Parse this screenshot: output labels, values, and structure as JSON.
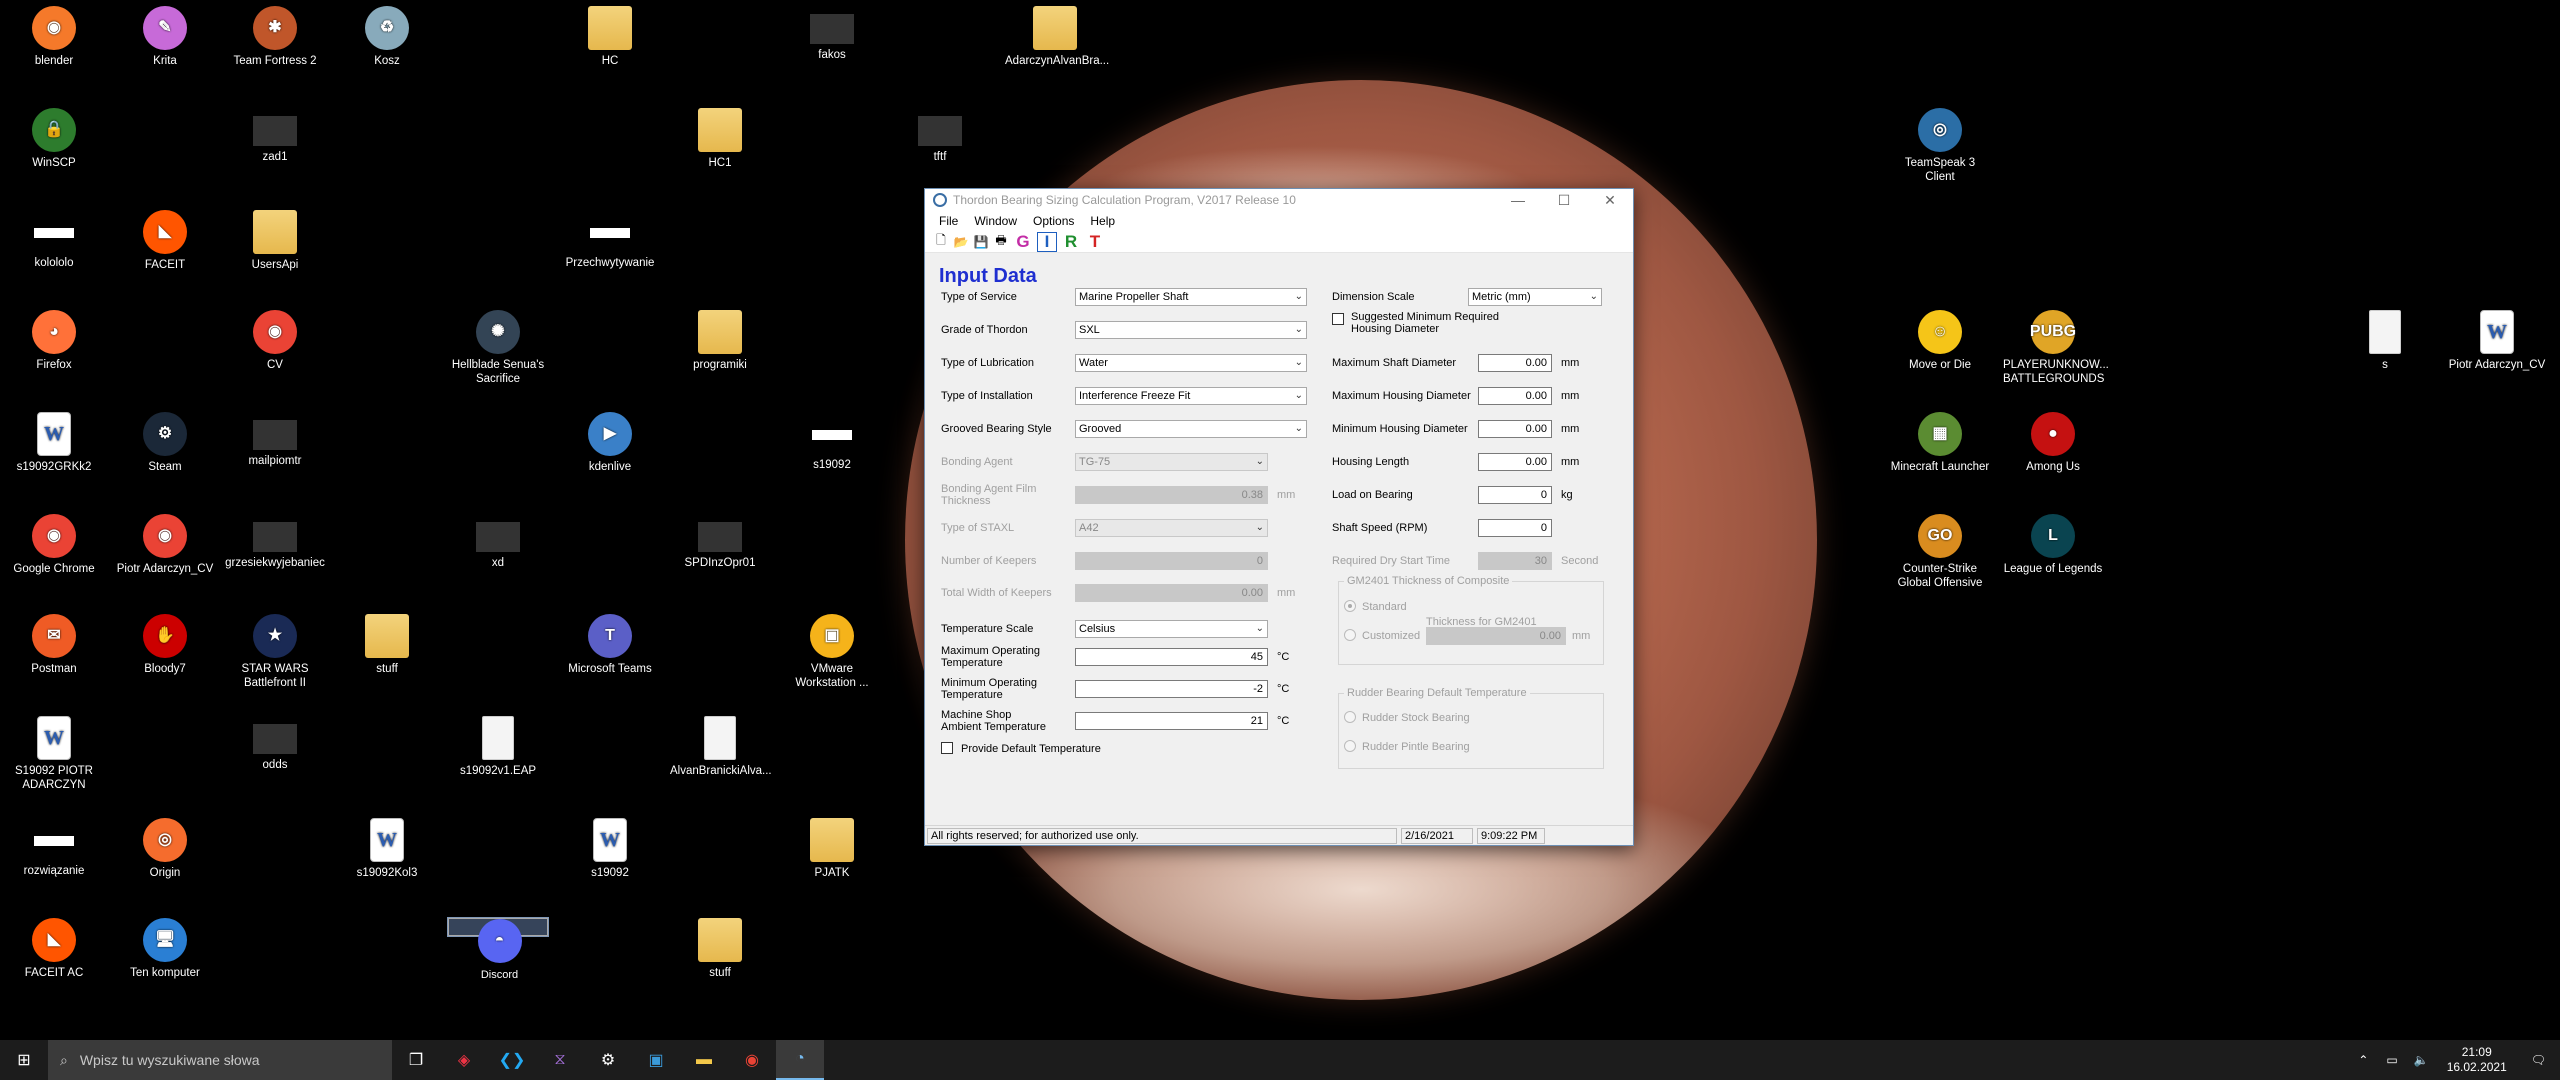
{
  "desktop": {
    "icons": [
      {
        "label": "blender",
        "glyph": "◉",
        "color": "#f5792a"
      },
      {
        "label": "Krita",
        "glyph": "✎",
        "color": "#c76ad8"
      },
      {
        "label": "Team Fortress 2",
        "glyph": "✱",
        "color": "#c0562a"
      },
      {
        "label": "Kosz",
        "glyph": "♻",
        "color": "#8ab"
      },
      {
        "label": "HC",
        "glyph": "",
        "color": ""
      },
      {
        "label": "fakos",
        "glyph": "",
        "color": ""
      },
      {
        "label": "AdarczynAlvanBra...",
        "glyph": "",
        "color": ""
      },
      {
        "label": "WinSCP",
        "glyph": "🔒",
        "color": "#2d7c2d"
      },
      {
        "label": "zad1",
        "glyph": "",
        "color": ""
      },
      {
        "label": "HC1",
        "glyph": "",
        "color": ""
      },
      {
        "label": "tftf",
        "glyph": "",
        "color": ""
      },
      {
        "label": "TeamSpeak 3 Client",
        "glyph": "◎",
        "color": "#2b6ea6"
      },
      {
        "label": "kolololo",
        "glyph": "",
        "color": ""
      },
      {
        "label": "FACEIT",
        "glyph": "◣",
        "color": "#f50"
      },
      {
        "label": "UsersApi",
        "glyph": "",
        "color": ""
      },
      {
        "label": "Przechwytywanie",
        "glyph": "",
        "color": ""
      },
      {
        "label": "Firefox",
        "glyph": "◕",
        "color": "#ff7139"
      },
      {
        "label": "CV",
        "glyph": "◉",
        "color": "#ea4335"
      },
      {
        "label": "Hellblade Senua's Sacrifice",
        "glyph": "✺",
        "color": "#345"
      },
      {
        "label": "programiki",
        "glyph": "",
        "color": ""
      },
      {
        "label": "Move or Die",
        "glyph": "☺",
        "color": "#f5c518"
      },
      {
        "label": "PLAYERUNKNOW... BATTLEGROUNDS",
        "glyph": "PUBG",
        "color": "#e0a526"
      },
      {
        "label": "s",
        "glyph": "",
        "color": ""
      },
      {
        "label": "Piotr Adarczyn_CV",
        "glyph": "W",
        "color": ""
      },
      {
        "label": "s19092GRKk2",
        "glyph": "W",
        "color": ""
      },
      {
        "label": "Steam",
        "glyph": "⚙",
        "color": "#1b2838"
      },
      {
        "label": "mailpiomtr",
        "glyph": "",
        "color": ""
      },
      {
        "label": "kdenlive",
        "glyph": "▶",
        "color": "#3a80c8"
      },
      {
        "label": "s19092",
        "glyph": "",
        "color": ""
      },
      {
        "label": "Minecraft Launcher",
        "glyph": "▦",
        "color": "#5b8c32"
      },
      {
        "label": "Among Us",
        "glyph": "●",
        "color": "#c51111"
      },
      {
        "label": "Google Chrome",
        "glyph": "◉",
        "color": "#ea4335"
      },
      {
        "label": "Piotr Adarczyn_CV",
        "glyph": "◉",
        "color": "#ea4335"
      },
      {
        "label": "grzesiekwyjebaniec",
        "glyph": "",
        "color": ""
      },
      {
        "label": "xd",
        "glyph": "",
        "color": ""
      },
      {
        "label": "SPDInzOpr01",
        "glyph": "",
        "color": ""
      },
      {
        "label": "Counter-Strike Global Offensive",
        "glyph": "GO",
        "color": "#d98c1f"
      },
      {
        "label": "League of Legends",
        "glyph": "L",
        "color": "#0a4450"
      },
      {
        "label": "Postman",
        "glyph": "✉",
        "color": "#ef5b25"
      },
      {
        "label": "Bloody7",
        "glyph": "✋",
        "color": "#c00"
      },
      {
        "label": "STAR WARS Battlefront II",
        "glyph": "★",
        "color": "#1a2a55"
      },
      {
        "label": "stuff",
        "glyph": "",
        "color": ""
      },
      {
        "label": "Microsoft Teams",
        "glyph": "T",
        "color": "#5b5fc7"
      },
      {
        "label": "VMware Workstation ...",
        "glyph": "▣",
        "color": "#f5b31a"
      },
      {
        "label": "S19092 PIOTR ADARCZYN",
        "glyph": "W",
        "color": ""
      },
      {
        "label": "odds",
        "glyph": "",
        "color": ""
      },
      {
        "label": "s19092v1.EAP",
        "glyph": "",
        "color": ""
      },
      {
        "label": "AlvanBranickiAlva...",
        "glyph": "",
        "color": ""
      },
      {
        "label": "rozwiązanie",
        "glyph": "",
        "color": ""
      },
      {
        "label": "Origin",
        "glyph": "◎",
        "color": "#f56c2d"
      },
      {
        "label": "s19092Kol3",
        "glyph": "W",
        "color": ""
      },
      {
        "label": "s19092",
        "glyph": "W",
        "color": ""
      },
      {
        "label": "PJATK",
        "glyph": "",
        "color": ""
      },
      {
        "label": "FACEIT AC",
        "glyph": "◣",
        "color": "#f50"
      },
      {
        "label": "Ten komputer",
        "glyph": "🖥",
        "color": "#2a7fd4"
      },
      {
        "label": "Discord",
        "glyph": "◓",
        "color": "#5865f2"
      },
      {
        "label": "stuff",
        "glyph": "",
        "color": ""
      }
    ]
  },
  "window": {
    "title": "Thordon Bearing Sizing Calculation Program, V2017 Release 10",
    "menu": [
      "File",
      "Window",
      "Options",
      "Help"
    ],
    "toolbar": {
      "g": "G",
      "i": "I",
      "r": "R",
      "t": "T"
    },
    "heading": "Input Data",
    "left": {
      "type_of_service": {
        "label": "Type of Service",
        "value": "Marine Propeller Shaft"
      },
      "grade": {
        "label": "Grade of Thordon",
        "value": "SXL"
      },
      "lubrication": {
        "label": "Type of Lubrication",
        "value": "Water"
      },
      "installation": {
        "label": "Type of Installation",
        "value": "Interference Freeze Fit"
      },
      "groove": {
        "label": "Grooved Bearing Style",
        "value": "Grooved"
      },
      "bonding_agent": {
        "label": "Bonding Agent",
        "value": "TG-75"
      },
      "bonding_thickness": {
        "label": "Bonding Agent Film Thickness",
        "value": "0.38",
        "unit": "mm"
      },
      "stayl": {
        "label": "Type of STAXL",
        "value": "A42"
      },
      "keepers": {
        "label": "Number of Keepers",
        "value": "0"
      },
      "keepers_width": {
        "label": "Total Width of Keepers",
        "value": "0.00",
        "unit": "mm"
      },
      "temp_scale": {
        "label": "Temperature Scale",
        "value": "Celsius"
      },
      "max_temp": {
        "label": "Maximum Operating Temperature",
        "value": "45",
        "unit": "°C"
      },
      "min_temp": {
        "label": "Minimum Operating Temperature",
        "value": "-2",
        "unit": "°C"
      },
      "shop_temp": {
        "label": "Machine Shop Ambient Temperature",
        "value": "21",
        "unit": "°C"
      },
      "default_temp": {
        "label": "Provide Default Temperature"
      }
    },
    "right": {
      "dimension": {
        "label": "Dimension Scale",
        "value": "Metric (mm)"
      },
      "suggested": {
        "label": "Suggested Minimum Required Housing Diameter"
      },
      "max_shaft": {
        "label": "Maximum Shaft Diameter",
        "value": "0.00",
        "unit": "mm"
      },
      "max_housing": {
        "label": "Maximum Housing Diameter",
        "value": "0.00",
        "unit": "mm"
      },
      "min_housing": {
        "label": "Minimum Housing Diameter",
        "value": "0.00",
        "unit": "mm"
      },
      "housing_length": {
        "label": "Housing Length",
        "value": "0.00",
        "unit": "mm"
      },
      "load": {
        "label": "Load on Bearing",
        "value": "0",
        "unit": "kg"
      },
      "speed": {
        "label": "Shaft Speed (RPM)",
        "value": "0"
      },
      "dry_start": {
        "label": "Required Dry Start Time",
        "value": "30",
        "unit": "Second"
      },
      "gm_group": {
        "title": "GM2401 Thickness of Composite",
        "standard": "Standard",
        "customized": "Customized",
        "thick_label": "Thickness for GM2401",
        "thick_value": "0.00",
        "unit": "mm"
      },
      "rudder_group": {
        "title": "Rudder Bearing Default Temperature",
        "stock": "Rudder Stock Bearing",
        "pintle": "Rudder Pintle Bearing"
      }
    },
    "status": {
      "rights": "All rights reserved; for authorized use only.",
      "date": "2/16/2021",
      "time": "9:09:22 PM"
    }
  },
  "taskbar": {
    "search_placeholder": "Wpisz tu wyszukiwane słowa",
    "time": "21:09",
    "date": "16.02.2021"
  }
}
